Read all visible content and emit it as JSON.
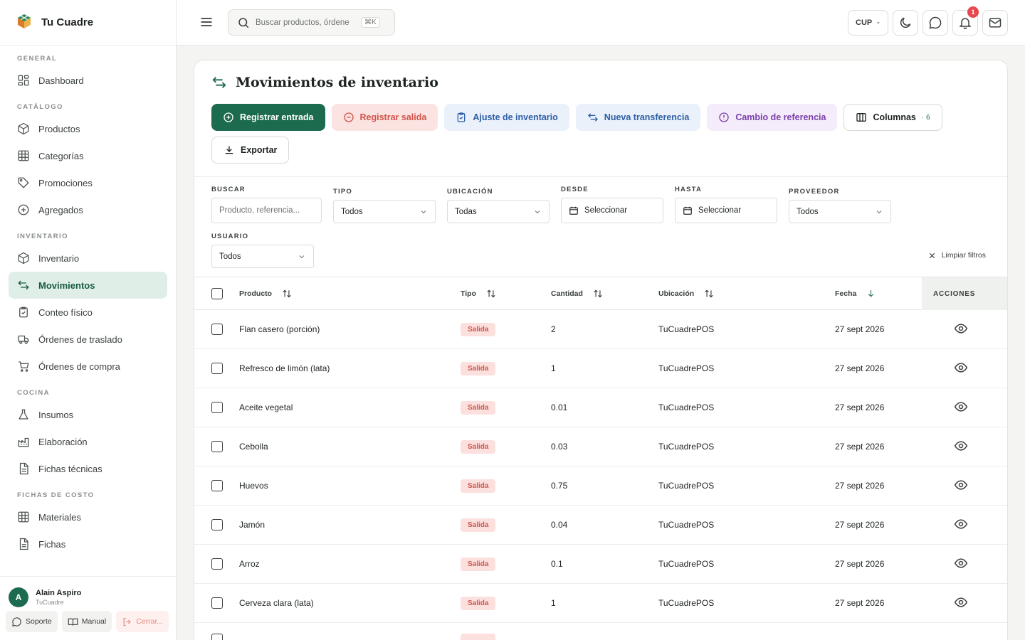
{
  "brand": {
    "name": "Tu Cuadre"
  },
  "sidebar": {
    "sections": [
      {
        "title": "GENERAL",
        "items": [
          {
            "label": "Dashboard",
            "icon": "dashboard-icon"
          }
        ]
      },
      {
        "title": "CATÁLOGO",
        "items": [
          {
            "label": "Productos",
            "icon": "box-icon"
          },
          {
            "label": "Categorías",
            "icon": "grid-icon"
          },
          {
            "label": "Promociones",
            "icon": "tag-icon"
          },
          {
            "label": "Agregados",
            "icon": "plus-circle-icon"
          }
        ]
      },
      {
        "title": "INVENTARIO",
        "items": [
          {
            "label": "Inventario",
            "icon": "box-icon"
          },
          {
            "label": "Movimientos",
            "icon": "transfer-icon",
            "active": true
          },
          {
            "label": "Conteo físico",
            "icon": "clipboard-icon"
          },
          {
            "label": "Órdenes de traslado",
            "icon": "truck-icon"
          },
          {
            "label": "Órdenes de compra",
            "icon": "cart-icon"
          }
        ]
      },
      {
        "title": "COCINA",
        "items": [
          {
            "label": "Insumos",
            "icon": "flask-icon"
          },
          {
            "label": "Elaboración",
            "icon": "factory-icon"
          },
          {
            "label": "Fichas técnicas",
            "icon": "document-icon"
          }
        ]
      },
      {
        "title": "FICHAS DE COSTO",
        "items": [
          {
            "label": "Materiales",
            "icon": "grid-icon"
          },
          {
            "label": "Fichas",
            "icon": "document-icon"
          }
        ]
      }
    ],
    "user": {
      "initial": "A",
      "name": "Alain Aspiro",
      "org": "TuCuadre"
    },
    "footer": {
      "support": "Soporte",
      "manual": "Manual",
      "logout": "Cerrar..."
    }
  },
  "topbar": {
    "search_placeholder": "Buscar productos, órdene",
    "shortcut": "⌘K",
    "currency": "CUP",
    "notifications_count": "1"
  },
  "page": {
    "title": "Movimientos de inventario",
    "actions": {
      "entry": "Registrar entrada",
      "exit": "Registrar salida",
      "adjust": "Ajuste de inventario",
      "transfer": "Nueva transferencia",
      "reference": "Cambio de referencia",
      "columns": "Columnas",
      "columns_count": "· 6",
      "export": "Exportar"
    },
    "filters": {
      "search_label": "BUSCAR",
      "search_placeholder": "Producto, referencia...",
      "type_label": "TIPO",
      "type_value": "Todos",
      "location_label": "UBICACIÓN",
      "location_value": "Todas",
      "from_label": "DESDE",
      "from_value": "Seleccionar",
      "to_label": "HASTA",
      "to_value": "Seleccionar",
      "supplier_label": "PROVEEDOR",
      "supplier_value": "Todos",
      "user_label": "USUARIO",
      "user_value": "Todos",
      "clear": "Limpiar filtros"
    },
    "table": {
      "headers": {
        "product": "Producto",
        "type": "Tipo",
        "quantity": "Cantidad",
        "location": "Ubicación",
        "date": "Fecha",
        "actions": "ACCIONES"
      },
      "rows": [
        {
          "product": "Flan casero (porción)",
          "type": "Salida",
          "quantity": "2",
          "location": "TuCuadrePOS",
          "date": "27 sept 2026"
        },
        {
          "product": "Refresco de limón (lata)",
          "type": "Salida",
          "quantity": "1",
          "location": "TuCuadrePOS",
          "date": "27 sept 2026"
        },
        {
          "product": "Aceite vegetal",
          "type": "Salida",
          "quantity": "0.01",
          "location": "TuCuadrePOS",
          "date": "27 sept 2026"
        },
        {
          "product": "Cebolla",
          "type": "Salida",
          "quantity": "0.03",
          "location": "TuCuadrePOS",
          "date": "27 sept 2026"
        },
        {
          "product": "Huevos",
          "type": "Salida",
          "quantity": "0.75",
          "location": "TuCuadrePOS",
          "date": "27 sept 2026"
        },
        {
          "product": "Jamón",
          "type": "Salida",
          "quantity": "0.04",
          "location": "TuCuadrePOS",
          "date": "27 sept 2026"
        },
        {
          "product": "Arroz",
          "type": "Salida",
          "quantity": "0.1",
          "location": "TuCuadrePOS",
          "date": "27 sept 2026"
        },
        {
          "product": "Cerveza clara (lata)",
          "type": "Salida",
          "quantity": "1",
          "location": "TuCuadrePOS",
          "date": "27 sept 2026"
        }
      ]
    }
  },
  "colors": {
    "primary": "#1d6b4f",
    "danger": "#d1544b",
    "active_bg": "#dfeee7"
  }
}
